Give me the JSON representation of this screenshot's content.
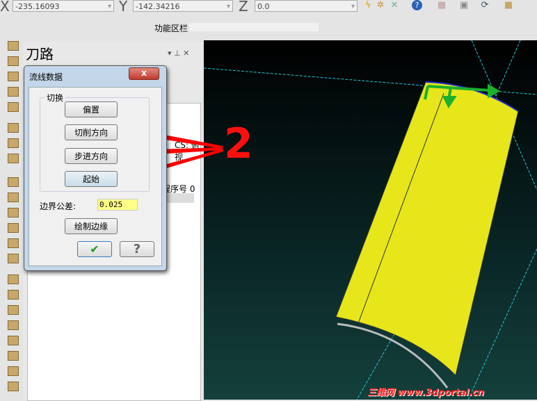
{
  "toolbar": {
    "x_label": "X",
    "x_value": "-235.16093",
    "y_label": "Y",
    "y_value": "-142.34216",
    "z_label": "Z",
    "z_value": "0.0",
    "ribbon_label": "功能区栏"
  },
  "panel": {
    "title": "刀路",
    "view_text": "CS: 俯视",
    "program_label": "程序号 0"
  },
  "dialog": {
    "title": "流线数据",
    "group": "切换",
    "buttons": [
      "偏置",
      "切削方向",
      "步进方向",
      "起始"
    ],
    "tolerance_label": "边界公差:",
    "tolerance_value": "0.025",
    "draw_edge": "绘制边缘",
    "ok": "✔",
    "help": "?",
    "close": "x"
  },
  "annotation": {
    "number": "2"
  },
  "watermark": "三维网 www.3dportal.cn",
  "colors": {
    "viewport": "#0f2e2e",
    "part": "#e6e61a",
    "arrow": "#ff0000"
  }
}
